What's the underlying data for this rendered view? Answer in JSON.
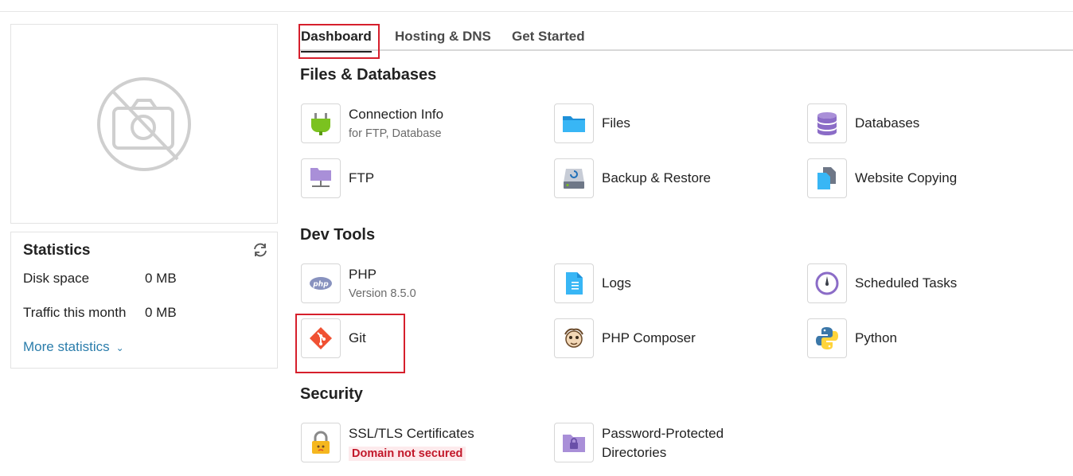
{
  "tabs": [
    {
      "label": "Dashboard",
      "active": true
    },
    {
      "label": "Hosting & DNS",
      "active": false
    },
    {
      "label": "Get Started",
      "active": false
    }
  ],
  "stats": {
    "title": "Statistics",
    "rows": [
      {
        "label": "Disk space",
        "value": "0 MB"
      },
      {
        "label": "Traffic this month",
        "value": "0 MB"
      }
    ],
    "more_label": "More statistics"
  },
  "sections": [
    {
      "title": "Files & Databases",
      "tools": [
        {
          "name": "Connection Info",
          "sub": "for FTP, Database",
          "icon": "plug-icon"
        },
        {
          "name": "Files",
          "icon": "folder-icon"
        },
        {
          "name": "Databases",
          "icon": "database-icon"
        },
        {
          "name": "FTP",
          "icon": "ftp-folder-icon"
        },
        {
          "name": "Backup & Restore",
          "icon": "backup-drive-icon"
        },
        {
          "name": "Website Copying",
          "icon": "copy-files-icon"
        }
      ]
    },
    {
      "title": "Dev Tools",
      "tools": [
        {
          "name": "PHP",
          "sub": "Version 8.5.0",
          "icon": "php-icon"
        },
        {
          "name": "Logs",
          "icon": "log-file-icon"
        },
        {
          "name": "Scheduled Tasks",
          "icon": "clock-icon"
        },
        {
          "name": "Git",
          "icon": "git-icon"
        },
        {
          "name": "PHP Composer",
          "icon": "composer-icon"
        },
        {
          "name": "Python",
          "icon": "python-icon"
        }
      ]
    },
    {
      "title": "Security",
      "tools": [
        {
          "name": "SSL/TLS Certificates",
          "badge": "Domain not secured",
          "icon": "lock-icon"
        },
        {
          "name": "Password-Protected",
          "name2": "Directories",
          "icon": "locked-folder-icon"
        }
      ]
    }
  ],
  "colors": {
    "accent_link": "#2b7dab",
    "highlight_border": "#d61f2c",
    "warning_text": "#c2182a"
  }
}
